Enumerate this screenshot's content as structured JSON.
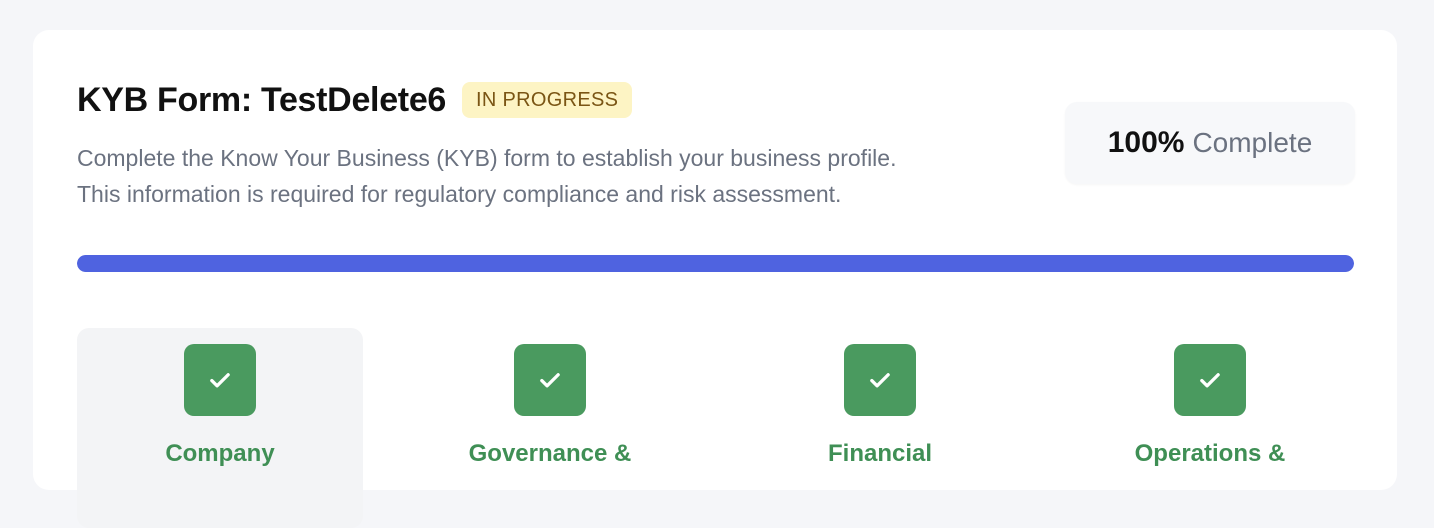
{
  "form": {
    "title": "KYB Form: TestDelete6",
    "status": "IN PROGRESS",
    "description_line1": "Complete the Know Your Business (KYB) form to establish your business profile.",
    "description_line2": "This information is required for regulatory compliance and risk assessment."
  },
  "completion": {
    "percent_label": "100%",
    "label": "Complete",
    "progress_fraction": 1.0
  },
  "steps": [
    {
      "label": "Company",
      "icon": "check-icon",
      "status": "complete",
      "active": true
    },
    {
      "label": "Governance &",
      "icon": "check-icon",
      "status": "complete",
      "active": false
    },
    {
      "label": "Financial",
      "icon": "check-icon",
      "status": "complete",
      "active": false
    },
    {
      "label": "Operations &",
      "icon": "check-icon",
      "status": "complete",
      "active": false
    }
  ],
  "colors": {
    "accent": "#4f63e0",
    "success": "#4a9a5f",
    "badge_bg": "#fdf4c4",
    "badge_text": "#7a5514"
  }
}
